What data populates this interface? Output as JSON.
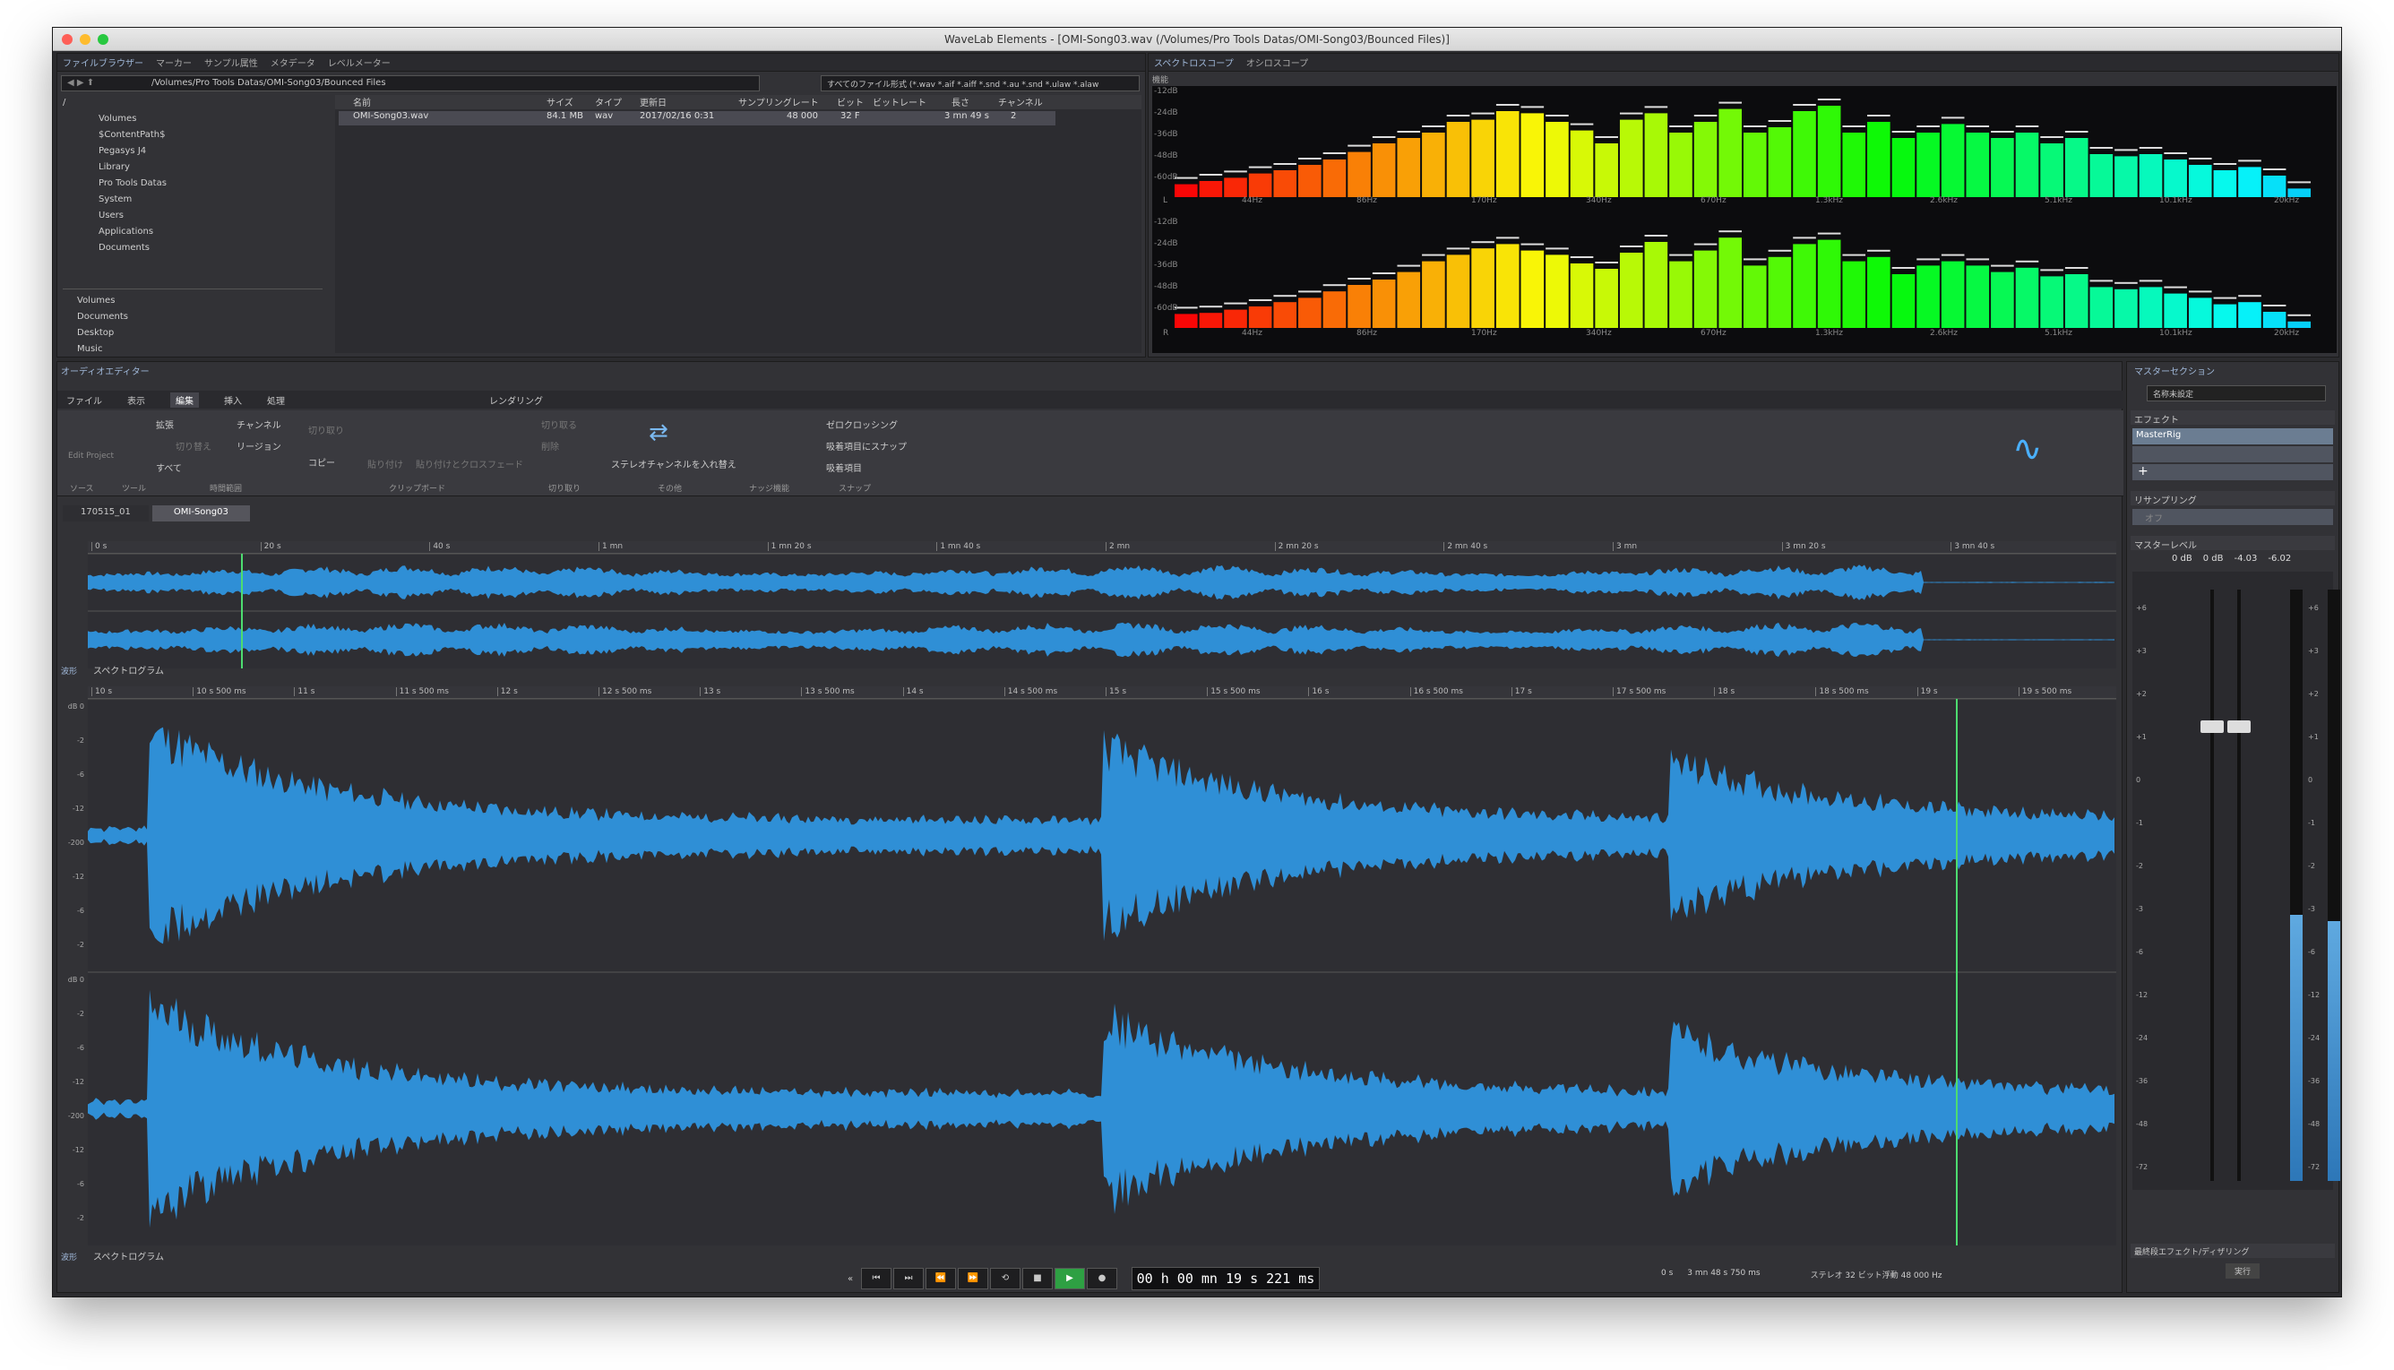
{
  "window_title": "WaveLab Elements - [OMI-Song03.wav (/Volumes/Pro Tools Datas/OMI-Song03/Bounced Files)]",
  "browser": {
    "tabs": [
      "ファイルブラウザー",
      "マーカー",
      "サンプル属性",
      "メタデータ",
      "レベルメーター"
    ],
    "path": "/Volumes/Pro Tools Datas/OMI-Song03/Bounced Files",
    "filter": "すべてのファイル形式 (*.wav *.aif *.aiff *.snd *.au *.snd *.ulaw *.alaw",
    "tree": [
      "/",
      "Volumes",
      "$ContentPath$",
      "Pegasys J4",
      "Library",
      "Pro Tools Datas",
      "System",
      "Users",
      "Applications",
      "Documents"
    ],
    "favorites": [
      "Volumes",
      "Documents",
      "Desktop",
      "Music"
    ],
    "columns": [
      "名前",
      "サイズ",
      "タイプ",
      "更新日",
      "サンプリングレート",
      "ビット",
      "ビットレート",
      "長さ",
      "チャンネル"
    ],
    "files": [
      {
        "name": "OMI-Song03.wav",
        "size": "84.1 MB",
        "type": "wav",
        "date": "2017/02/16 0:31",
        "rate": "48 000",
        "bits": "32 F",
        "bitrate": "",
        "length": "3 mn 49 s",
        "channels": "2"
      }
    ]
  },
  "scope": {
    "tabs": [
      "スペクトロスコープ",
      "オシロスコープ"
    ],
    "label": "機能",
    "db_labels": [
      "-12dB",
      "-24dB",
      "-36dB",
      "-48dB",
      "-60dB"
    ],
    "freq_labels": [
      "44Hz",
      "86Hz",
      "170Hz",
      "340Hz",
      "670Hz",
      "1.3kHz",
      "2.6kHz",
      "5.1kHz",
      "10.1kHz",
      "20kHz"
    ],
    "channels": [
      "L",
      "R"
    ],
    "levels_L": [
      0.12,
      0.15,
      0.18,
      0.22,
      0.25,
      0.3,
      0.35,
      0.42,
      0.5,
      0.55,
      0.6,
      0.7,
      0.72,
      0.8,
      0.78,
      0.7,
      0.62,
      0.5,
      0.72,
      0.78,
      0.6,
      0.7,
      0.82,
      0.6,
      0.65,
      0.8,
      0.85,
      0.6,
      0.7,
      0.55,
      0.6,
      0.68,
      0.6,
      0.55,
      0.6,
      0.5,
      0.55,
      0.4,
      0.38,
      0.4,
      0.35,
      0.3,
      0.25,
      0.28,
      0.2,
      0.08
    ],
    "levels_R": [
      0.13,
      0.14,
      0.17,
      0.2,
      0.24,
      0.28,
      0.34,
      0.4,
      0.45,
      0.52,
      0.62,
      0.68,
      0.74,
      0.78,
      0.72,
      0.68,
      0.6,
      0.55,
      0.7,
      0.8,
      0.62,
      0.72,
      0.84,
      0.58,
      0.66,
      0.78,
      0.82,
      0.62,
      0.66,
      0.5,
      0.58,
      0.62,
      0.58,
      0.52,
      0.56,
      0.48,
      0.5,
      0.38,
      0.36,
      0.38,
      0.32,
      0.28,
      0.22,
      0.24,
      0.15,
      0.06
    ]
  },
  "editor": {
    "title": "オーディオエディター",
    "tabs": [
      "ファイル",
      "表示",
      "編集",
      "挿入",
      "処理",
      "レンダリング"
    ],
    "ribbon": {
      "edit_project": "Edit Project",
      "expand": "拡張",
      "cut": "切り替え",
      "all": "すべて",
      "channel": "チャンネル",
      "region": "リージョン",
      "trim": "切り取り",
      "copy": "コピー",
      "paste": "貼り付け",
      "crossfade": "貼り付けとクロスフェード",
      "crop": "切り取る",
      "delete": "削除",
      "swap": "ステレオチャンネルを入れ替え",
      "zero": "ゼロクロッシング",
      "snap": "吸着項目にスナップ",
      "snap_items": "吸着項目",
      "groups": [
        "ソース",
        "ツール",
        "時間範囲",
        "クリップボード",
        "切り取り",
        "その他",
        "ナッジ機能",
        "スナップ"
      ]
    },
    "file_tabs": [
      "170515_01",
      "OMI-Song03"
    ],
    "overview_ticks": [
      "0 s",
      "20 s",
      "40 s",
      "1 mn",
      "1 mn 20 s",
      "1 mn 40 s",
      "2 mn",
      "2 mn 20 s",
      "2 mn 40 s",
      "3 mn",
      "3 mn 20 s",
      "3 mn 40 s"
    ],
    "detail_ticks": [
      "10 s",
      "10 s 500 ms",
      "11 s",
      "11 s 500 ms",
      "12 s",
      "12 s 500 ms",
      "13 s",
      "13 s 500 ms",
      "14 s",
      "14 s 500 ms",
      "15 s",
      "15 s 500 ms",
      "16 s",
      "16 s 500 ms",
      "17 s",
      "17 s 500 ms",
      "18 s",
      "18 s 500 ms",
      "19 s",
      "19 s 500 ms"
    ],
    "db_scale": [
      "dB 0",
      "-2",
      "-6",
      "-12",
      "-200",
      "-12",
      "-6",
      "-2"
    ],
    "view_label": "スペクトログラム",
    "wave_label": "波形",
    "status_start": "0 s",
    "status_length": "3 mn 48 s 750 ms",
    "status_format": "ステレオ 32 ビット浮動 48 000 Hz"
  },
  "transport": {
    "time": "00 h 00 mn 19 s 221 ms"
  },
  "master": {
    "title": "マスターセクション",
    "preset": "名称未設定",
    "effects_label": "エフェクト",
    "plugin": "MasterRig",
    "resampling_label": "リサンプリング",
    "resampling_value": "オフ",
    "level_label": "マスターレベル",
    "level_values": [
      "0 dB",
      "0 dB",
      "-4.03",
      "-6.02"
    ],
    "scale": [
      "+6",
      "+3",
      "+2",
      "+1",
      "0",
      "-1",
      "-2",
      "-3",
      "-6",
      "-12",
      "-24",
      "-36",
      "-48",
      "-72"
    ],
    "meter_L": 0.45,
    "meter_R": 0.44,
    "final_label": "最終段エフェクト/ディザリング",
    "render_label": "実行"
  }
}
